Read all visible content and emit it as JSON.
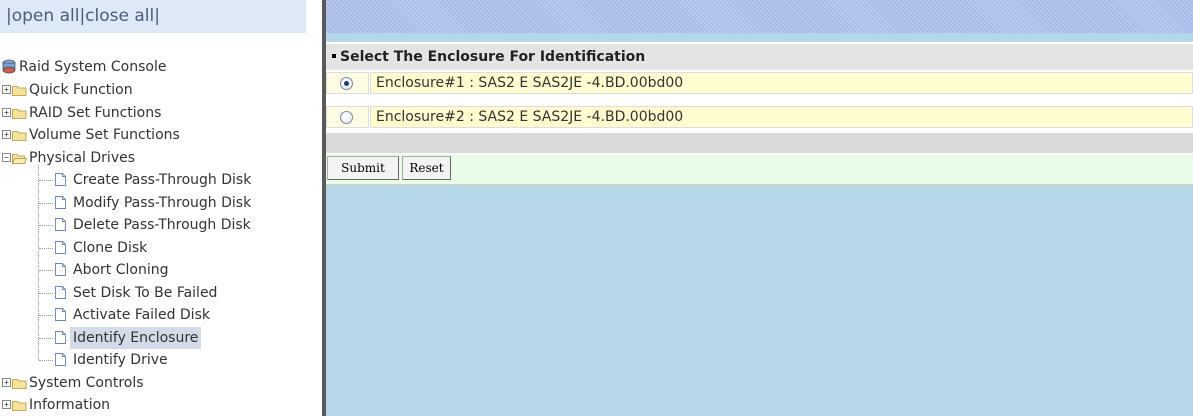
{
  "nav": {
    "open_all": "open all",
    "close_all": "close all",
    "sep": "|"
  },
  "tree": {
    "root": "Raid System Console",
    "items": [
      {
        "label": "Quick Function",
        "expanded": false
      },
      {
        "label": "RAID Set Functions",
        "expanded": false
      },
      {
        "label": "Volume Set Functions",
        "expanded": false
      },
      {
        "label": "Physical Drives",
        "expanded": true
      },
      {
        "label": "System Controls",
        "expanded": false
      },
      {
        "label": "Information",
        "expanded": false
      }
    ],
    "physical_children": [
      "Create Pass-Through Disk",
      "Modify Pass-Through Disk",
      "Delete Pass-Through Disk",
      "Clone Disk",
      "Abort Cloning",
      "Set Disk To Be Failed",
      "Activate Failed Disk",
      "Identify Enclosure",
      "Identify Drive"
    ],
    "selected": "Identify Enclosure"
  },
  "panel": {
    "title": "Select The Enclosure For Identification",
    "enclosures": [
      {
        "label": "Enclosure#1 : SAS2 E SAS2JE -4.BD.00bd00",
        "checked": true
      },
      {
        "label": "Enclosure#2 : SAS2 E SAS2JE -4.BD.00bd00",
        "checked": false
      }
    ],
    "submit": "Submit",
    "reset": "Reset"
  },
  "colors": {
    "tree_selected": "#d3dbe8",
    "content_bg": "#b6d7e7",
    "row_bg": "#fffccf",
    "button_bar": "#e9fce9"
  }
}
